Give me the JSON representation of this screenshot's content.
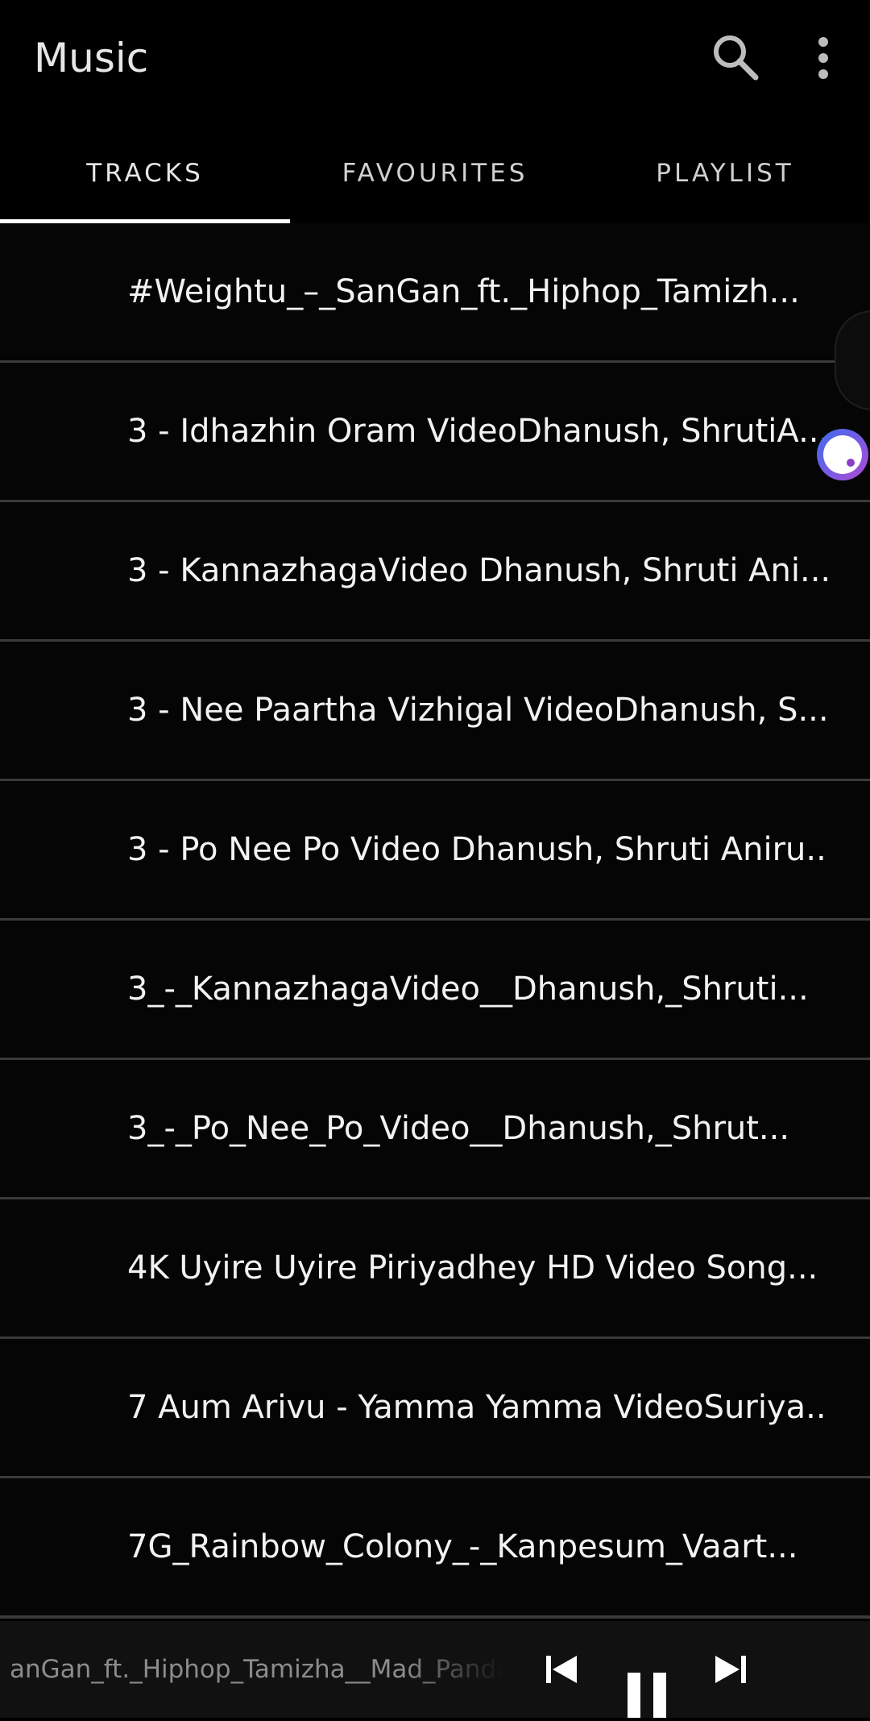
{
  "app_bar": {
    "title": "Music",
    "icons": {
      "search": "search-icon",
      "more": "more-vertical-icon"
    }
  },
  "tabs": [
    {
      "label": "TRACKS",
      "selected": true
    },
    {
      "label": "FAVOURITES",
      "selected": false
    },
    {
      "label": "PLAYLIST",
      "selected": false
    }
  ],
  "tracks": [
    {
      "title": "#Weightu_–_SanGan_ft._Hiphop_Tamizh..."
    },
    {
      "title": "3 - Idhazhin Oram VideoDhanush, ShrutiA..."
    },
    {
      "title": "3 - KannazhagaVideo Dhanush, Shruti Ani..."
    },
    {
      "title": "3 - Nee Paartha Vizhigal VideoDhanush, S..."
    },
    {
      "title": "3 - Po Nee Po Video Dhanush, Shruti Aniru..."
    },
    {
      "title": "3_-_KannazhagaVideo__Dhanush,_Shruti..."
    },
    {
      "title": "3_-_Po_Nee_Po_Video__Dhanush,_Shrut..."
    },
    {
      "title": "4K Uyire Uyire Piriyadhey HD Video Song..."
    },
    {
      "title": "7 Aum Arivu - Yamma Yamma VideoSuriya..."
    },
    {
      "title": "7G_Rainbow_Colony_-_Kanpesum_Vaart..."
    }
  ],
  "player": {
    "now_playing": "anGan_ft._Hiphop_Tamizha__Mad_Panda",
    "state": "playing",
    "icons": {
      "prev": "skip-previous-icon",
      "pause": "pause-icon",
      "next": "skip-next-icon"
    }
  },
  "colors": {
    "background": "#000000",
    "divider": "#3a3a3a",
    "text": "#f2f2f2",
    "tab_indicator": "#ffffff",
    "player_bar": "#111111"
  }
}
